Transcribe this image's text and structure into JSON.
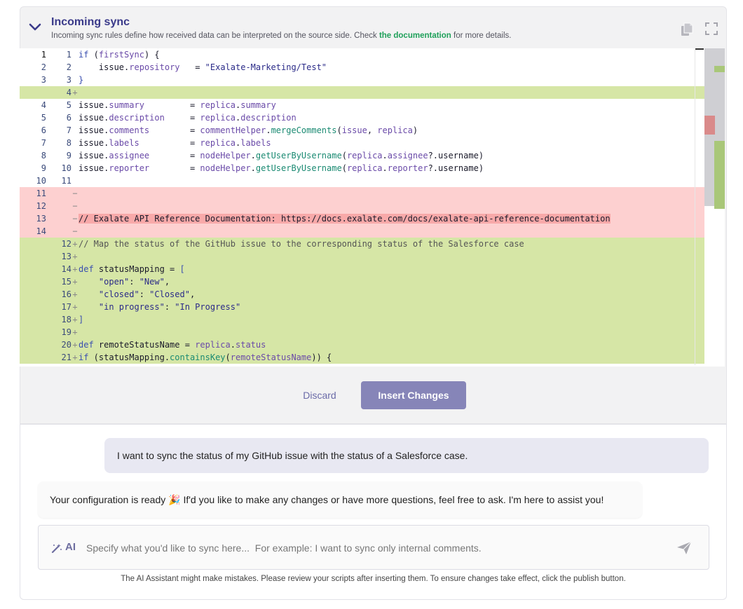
{
  "header": {
    "title": "Incoming sync",
    "desc_before": "Incoming sync rules define how received data can be interpreted on the source side. Check ",
    "desc_link": "the documentation",
    "desc_after": " for more details."
  },
  "editor": {
    "rows": [
      {
        "a": "1",
        "b": "1",
        "m": "",
        "t": "",
        "k": "ctx",
        "cur": true
      },
      {
        "a": "2",
        "b": "2",
        "m": "",
        "t": "",
        "k": "ctx"
      },
      {
        "a": "3",
        "b": "3",
        "m": "",
        "t": "",
        "k": "ctx"
      },
      {
        "a": "",
        "b": "4",
        "m": "+",
        "t": "",
        "k": "add"
      },
      {
        "a": "4",
        "b": "5",
        "m": "",
        "t": "",
        "k": "ctx"
      },
      {
        "a": "5",
        "b": "6",
        "m": "",
        "t": "",
        "k": "ctx"
      },
      {
        "a": "6",
        "b": "7",
        "m": "",
        "t": "",
        "k": "ctx"
      },
      {
        "a": "7",
        "b": "8",
        "m": "",
        "t": "",
        "k": "ctx"
      },
      {
        "a": "8",
        "b": "9",
        "m": "",
        "t": "",
        "k": "ctx"
      },
      {
        "a": "9",
        "b": "10",
        "m": "",
        "t": "",
        "k": "ctx"
      },
      {
        "a": "10",
        "b": "11",
        "m": "",
        "t": "",
        "k": "ctx"
      },
      {
        "a": "11",
        "b": "",
        "m": "−",
        "t": "",
        "k": "del"
      },
      {
        "a": "12",
        "b": "",
        "m": "−",
        "t": "",
        "k": "del"
      },
      {
        "a": "13",
        "b": "",
        "m": "−",
        "t": "",
        "k": "del"
      },
      {
        "a": "14",
        "b": "",
        "m": "−",
        "t": "",
        "k": "del"
      },
      {
        "a": "",
        "b": "12",
        "m": "+",
        "t": "",
        "k": "add"
      },
      {
        "a": "",
        "b": "13",
        "m": "+",
        "t": "",
        "k": "add"
      },
      {
        "a": "",
        "b": "14",
        "m": "+",
        "t": "",
        "k": "add"
      },
      {
        "a": "",
        "b": "15",
        "m": "+",
        "t": "",
        "k": "add"
      },
      {
        "a": "",
        "b": "16",
        "m": "+",
        "t": "",
        "k": "add"
      },
      {
        "a": "",
        "b": "17",
        "m": "+",
        "t": "",
        "k": "add"
      },
      {
        "a": "",
        "b": "18",
        "m": "+",
        "t": "",
        "k": "add"
      },
      {
        "a": "",
        "b": "19",
        "m": "+",
        "t": "",
        "k": "add"
      },
      {
        "a": "",
        "b": "20",
        "m": "+",
        "t": "",
        "k": "add"
      },
      {
        "a": "",
        "b": "21",
        "m": "+",
        "t": "",
        "k": "add"
      }
    ],
    "code": {
      "l1_kw": "if",
      "l1_rest1": " (",
      "l1_id": "firstSync",
      "l1_rest2": ") {",
      "l2_a": "    issue",
      "l2_b": ".",
      "l2_c": "repository",
      "l2_d": "   = ",
      "l2_s": "\"Exalate-Marketing/Test\"",
      "l3": "}",
      "l5_a": "issue",
      "l5_b": "summary",
      "l5_c": "replica",
      "l5_d": "summary",
      "l6_a": "issue",
      "l6_b": "description",
      "l6_c": "replica",
      "l6_d": "description",
      "l7_a": "issue",
      "l7_b": "comments",
      "l7_c": "commentHelper",
      "l7_d": "mergeComments",
      "l7_e": "issue",
      "l7_f": "replica",
      "l8_a": "issue",
      "l8_b": "labels",
      "l8_c": "replica",
      "l8_d": "labels",
      "l9_a": "issue",
      "l9_b": "assignee",
      "l9_c": "nodeHelper",
      "l9_d": "getUserByUsername",
      "l9_e": "replica",
      "l9_f": "assignee",
      "l9_g": "username",
      "l10_a": "issue",
      "l10_b": "reporter",
      "l10_c": "nodeHelper",
      "l10_d": "getUserByUsername",
      "l10_e": "replica",
      "l10_f": "reporter",
      "l10_g": "username",
      "del13": "// Exalate API Reference Documentation: https://docs.exalate.com/docs/exalate-api-reference-documentation",
      "n12": "// Map the status of the GitHub issue to the corresponding status of the Salesforce case",
      "n14_kw": "def",
      "n14_rest": " statusMapping = ",
      "n14_br": "[",
      "n15_k": "    \"open\"",
      "n15_v": "\"New\"",
      "n16_k": "    \"closed\"",
      "n16_v": "\"Closed\"",
      "n17_k": "    \"in progress\"",
      "n17_v": "\"In Progress\"",
      "n18": "]",
      "n20_kw": "def",
      "n20_rest": " remoteStatusName = ",
      "n20_id": "replica",
      "n20_f": "status",
      "n21_kw": "if",
      "n21_a": " (statusMapping.",
      "n21_fn": "containsKey",
      "n21_b": "(",
      "n21_id": "remoteStatusName",
      "n21_c": ")) {"
    }
  },
  "actions": {
    "discard": "Discard",
    "insert": "Insert Changes"
  },
  "chat": {
    "user_message": "I want to sync the status of my GitHub issue with the status of a Salesforce case.",
    "ai_message_before": "Your configuration is ready ",
    "ai_emoji": "🎉",
    "ai_message_after": " If'd you like to make any changes or have more questions, feel free to ask. I'm here to assist you!",
    "ai_label": "AI",
    "input_placeholder": "Specify what you'd like to sync here...  For example: I want to sync only internal comments.",
    "disclaimer": "The AI Assistant might make mistakes. Please review your scripts after inserting them. To ensure changes take effect, click the publish button."
  },
  "icons": {
    "collapse": "chevron-down-icon",
    "copy": "copy-icon",
    "expand": "fullscreen-icon",
    "wand": "magic-wand-icon",
    "send": "send-icon"
  },
  "colors": {
    "accent": "#3a3a8a",
    "link": "#1fa05a",
    "added_bg": "#d6e6a6",
    "removed_bg": "#fdd0d0",
    "insert_btn": "#8685b8"
  }
}
